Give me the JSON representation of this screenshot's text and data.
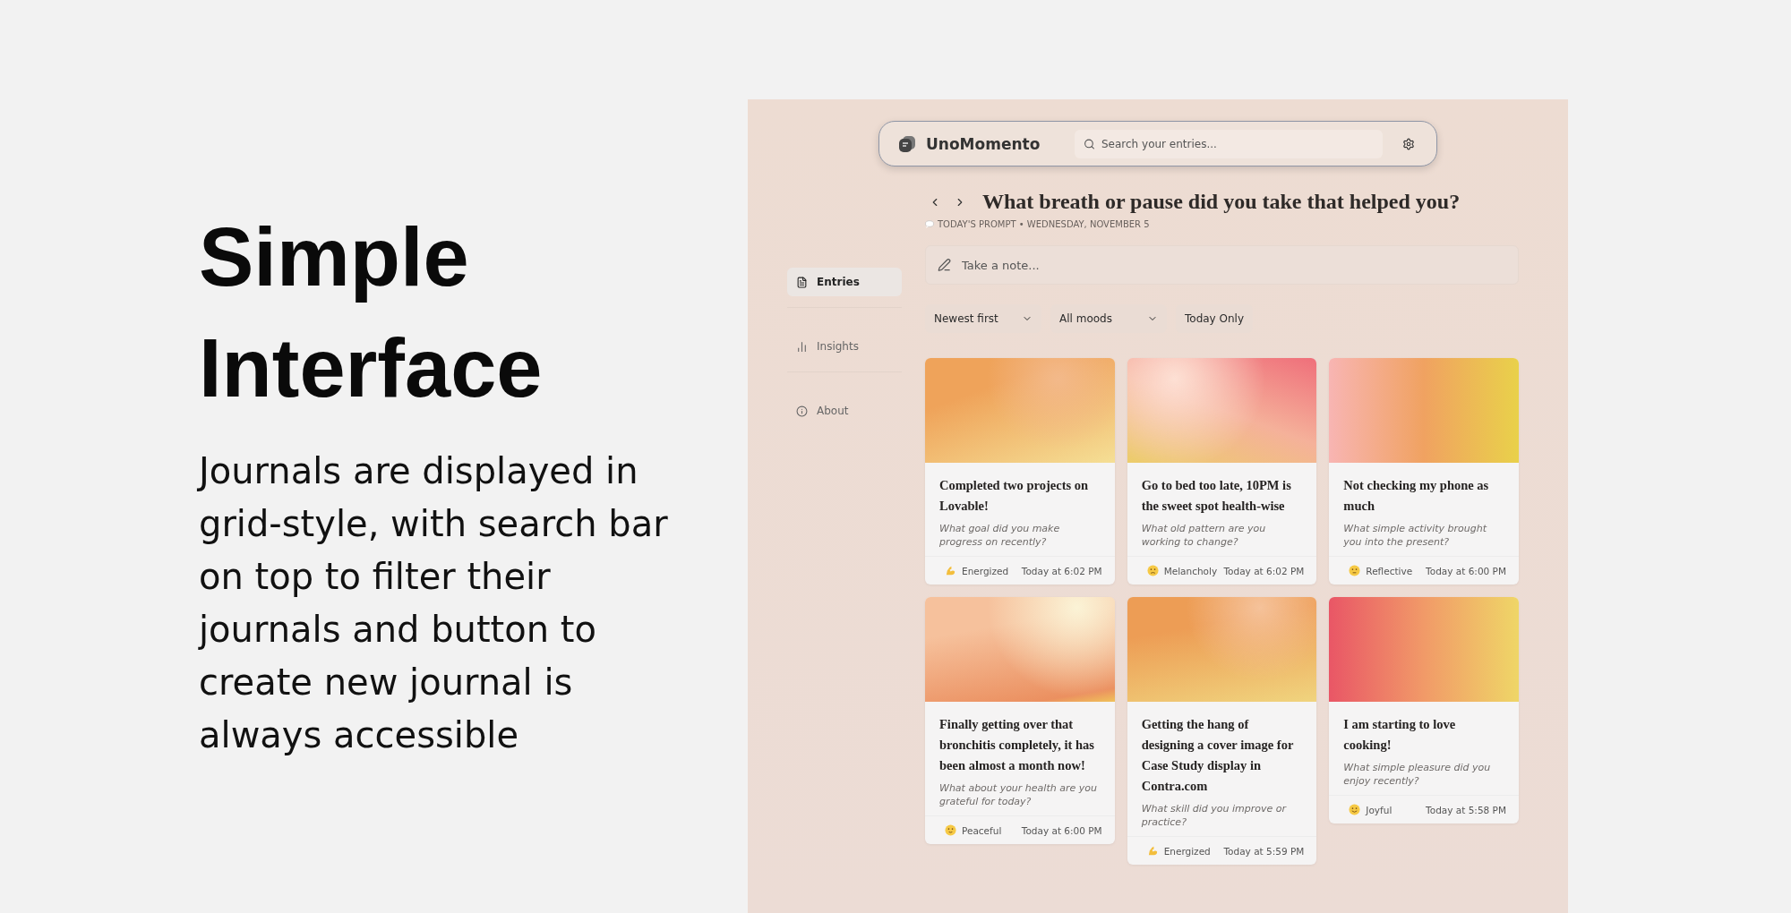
{
  "headline": [
    "Simple",
    "Interface"
  ],
  "description": "Journals are displayed in grid-style, with search bar on top to filter their journals and button to create new journal is always accessible",
  "app": {
    "brand": "UnoMomento",
    "search": {
      "placeholder": "Search your entries..."
    },
    "sidebar": {
      "items": [
        {
          "label": "Entries",
          "selected": true
        },
        {
          "label": "Insights",
          "selected": false
        },
        {
          "label": "About",
          "selected": false
        }
      ]
    },
    "prompt": {
      "title": "What breath or pause did you take that helped you?",
      "caption": "TODAY'S PROMPT • WEDNESDAY, NOVEMBER 5"
    },
    "note": {
      "placeholder": "Take a note..."
    },
    "filters": [
      {
        "kind": "dropdown",
        "label": "Newest first"
      },
      {
        "kind": "dropdown",
        "label": "All moods"
      },
      {
        "kind": "button",
        "label": "Today Only"
      }
    ],
    "entries": [
      {
        "title": "Completed two projects on Lovable!",
        "question": "What goal did you make progress on recently?",
        "mood": "Energized",
        "kind": "arm",
        "time": "Today at 6:02 PM"
      },
      {
        "title": "Go to bed too late, 10PM is the sweet spot health-wise",
        "question": "What old pattern are you working to change?",
        "mood": "Melancholy",
        "kind": "sad",
        "time": "Today at 6:02 PM"
      },
      {
        "title": "Not checking my phone as much",
        "question": "What simple activity brought you into the present?",
        "mood": "Reflective",
        "kind": "thinking",
        "time": "Today at 6:00 PM"
      },
      {
        "title": "Finally getting over that bronchitis completely, it has been almost a month now!",
        "question": "What about your health are you grateful for today?",
        "mood": "Peaceful",
        "kind": "calm",
        "time": "Today at 6:00 PM"
      },
      {
        "title": "Getting the hang of designing a cover image for Case Study display in Contra.com",
        "question": "What skill did you improve or practice?",
        "mood": "Energized",
        "kind": "arm",
        "time": "Today at 5:59 PM"
      },
      {
        "title": "I am starting to love cooking!",
        "question": "What simple pleasure did you enjoy recently?",
        "mood": "Joyful",
        "kind": "smile",
        "time": "Today at 5:58 PM"
      }
    ]
  }
}
